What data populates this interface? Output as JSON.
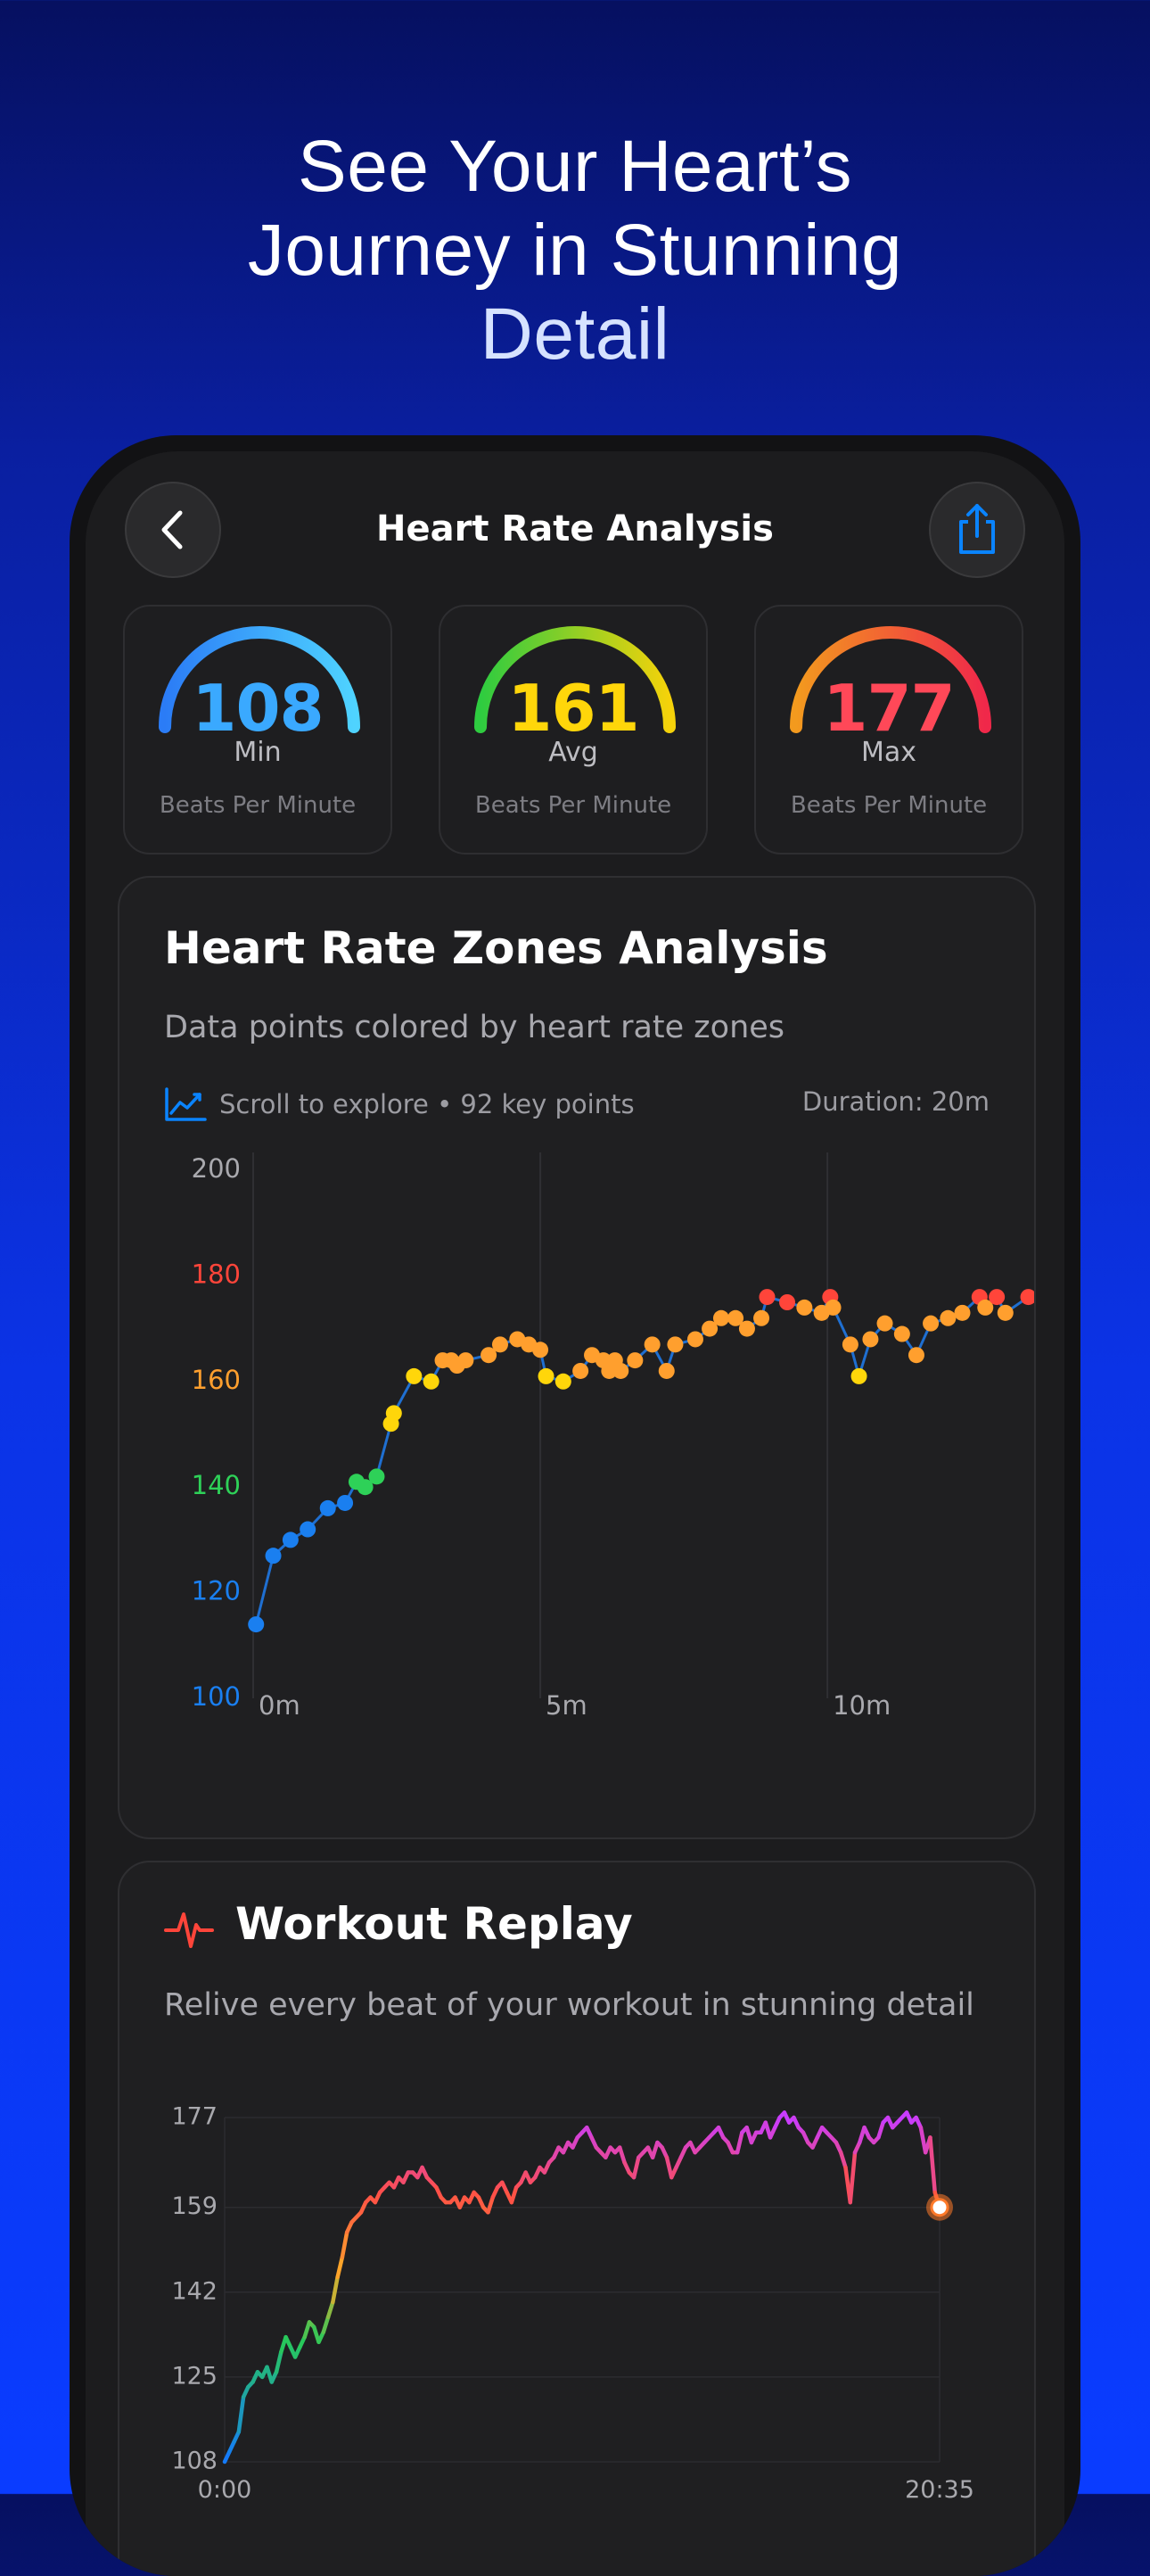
{
  "promo": {
    "line1": "See Your Heart’s",
    "line2": "Journey in Stunning",
    "line3": "Detail"
  },
  "nav": {
    "title": "Heart Rate Analysis"
  },
  "gauges": [
    {
      "value": "108",
      "label": "Min",
      "unit": "Beats Per Minute",
      "colors": [
        "#2b7cf6",
        "#4fd3ff"
      ]
    },
    {
      "value": "161",
      "label": "Avg",
      "unit": "Beats Per Minute",
      "colors": [
        "#2ecc40",
        "#f5d20a"
      ]
    },
    {
      "value": "177",
      "label": "Max",
      "unit": "Beats Per Minute",
      "colors": [
        "#f39a1e",
        "#f0284a"
      ]
    }
  ],
  "zones": {
    "title": "Heart Rate Zones Analysis",
    "subtitle": "Data points colored by heart rate zones",
    "scroll_hint": "Scroll to explore • 92 key points",
    "duration": "Duration: 20m"
  },
  "replay": {
    "title": "Workout Replay",
    "subtitle": "Relive every beat of your workout in stunning detail"
  },
  "colors": {
    "zone_blue": "#1a7ff0",
    "zone_green": "#2ed158",
    "zone_yellow": "#ffd60a",
    "zone_orange": "#ff9f2e",
    "zone_red": "#ff453a",
    "accent": "#0a84ff"
  },
  "chart_data": [
    {
      "type": "scatter",
      "title": "Heart Rate Zones Analysis",
      "xlabel": "",
      "ylabel": "",
      "ylim": [
        100,
        200
      ],
      "xlim": [
        0,
        13.6
      ],
      "y_ticks": [
        {
          "label": "200",
          "value": 200,
          "color": "#a9a9ae"
        },
        {
          "label": "180",
          "value": 180,
          "color": "#ff453a"
        },
        {
          "label": "160",
          "value": 160,
          "color": "#ff9f2e"
        },
        {
          "label": "140",
          "value": 140,
          "color": "#2ed158"
        },
        {
          "label": "120",
          "value": 120,
          "color": "#1a7ff0"
        },
        {
          "label": "100",
          "value": 100,
          "color": "#1a7ff0"
        }
      ],
      "x_ticks": [
        {
          "label": "0m",
          "value": 0
        },
        {
          "label": "5m",
          "value": 5
        },
        {
          "label": "10m",
          "value": 10
        }
      ],
      "points": [
        [
          0.05,
          114
        ],
        [
          0.35,
          127
        ],
        [
          0.65,
          130
        ],
        [
          0.95,
          132
        ],
        [
          1.3,
          136
        ],
        [
          1.6,
          137
        ],
        [
          1.8,
          141
        ],
        [
          1.95,
          140
        ],
        [
          2.15,
          142
        ],
        [
          2.4,
          152
        ],
        [
          2.45,
          154
        ],
        [
          2.8,
          161
        ],
        [
          3.1,
          160
        ],
        [
          3.3,
          164
        ],
        [
          3.45,
          164
        ],
        [
          3.55,
          163
        ],
        [
          3.7,
          164
        ],
        [
          4.1,
          165
        ],
        [
          4.3,
          167
        ],
        [
          4.6,
          168
        ],
        [
          4.8,
          167
        ],
        [
          5.0,
          166
        ],
        [
          5.1,
          161
        ],
        [
          5.4,
          160
        ],
        [
          5.7,
          162
        ],
        [
          5.9,
          165
        ],
        [
          6.1,
          164
        ],
        [
          6.2,
          162
        ],
        [
          6.3,
          164
        ],
        [
          6.4,
          162
        ],
        [
          6.65,
          164
        ],
        [
          6.95,
          167
        ],
        [
          7.2,
          162
        ],
        [
          7.35,
          167
        ],
        [
          7.7,
          168
        ],
        [
          7.95,
          170
        ],
        [
          8.15,
          172
        ],
        [
          8.4,
          172
        ],
        [
          8.6,
          170
        ],
        [
          8.85,
          172
        ],
        [
          8.95,
          176
        ],
        [
          9.3,
          175
        ],
        [
          9.6,
          174
        ],
        [
          9.9,
          173
        ],
        [
          10.05,
          176
        ],
        [
          10.1,
          174
        ],
        [
          10.4,
          167
        ],
        [
          10.55,
          161
        ],
        [
          10.75,
          168
        ],
        [
          11.0,
          171
        ],
        [
          11.3,
          169
        ],
        [
          11.55,
          165
        ],
        [
          11.8,
          171
        ],
        [
          12.1,
          172
        ],
        [
          12.35,
          173
        ],
        [
          12.65,
          176
        ],
        [
          12.75,
          174
        ],
        [
          12.95,
          176
        ],
        [
          13.1,
          173
        ],
        [
          13.5,
          176
        ]
      ]
    },
    {
      "type": "line",
      "title": "Workout Replay",
      "xlabel": "",
      "ylabel": "",
      "ylim": [
        108,
        177
      ],
      "y_ticks": [
        "177",
        "159",
        "142",
        "125",
        "108"
      ],
      "x_ticks": [
        "0:00",
        "20:35"
      ],
      "values": [
        108,
        110,
        112,
        114,
        121,
        123,
        124,
        126,
        125,
        127,
        124,
        126,
        130,
        133,
        131,
        129,
        131,
        133,
        136,
        135,
        132,
        134,
        137,
        140,
        145,
        149,
        154,
        156,
        157,
        158,
        160,
        161,
        160,
        162,
        163,
        164,
        163,
        165,
        164,
        166,
        166,
        165,
        167,
        165,
        164,
        163,
        161,
        160,
        160,
        161,
        159,
        161,
        160,
        162,
        161,
        159,
        158,
        161,
        163,
        164,
        162,
        160,
        163,
        164,
        166,
        164,
        165,
        167,
        166,
        168,
        169,
        171,
        170,
        172,
        171,
        173,
        174,
        175,
        173,
        171,
        170,
        169,
        171,
        170,
        171,
        168,
        166,
        165,
        169,
        170,
        171,
        169,
        172,
        171,
        169,
        165,
        167,
        169,
        171,
        172,
        170,
        171,
        172,
        173,
        174,
        175,
        173,
        172,
        170,
        170,
        174,
        175,
        172,
        174,
        174,
        176,
        173,
        175,
        177,
        178,
        176,
        177,
        175,
        174,
        172,
        171,
        173,
        175,
        174,
        173,
        172,
        170,
        167,
        160,
        170,
        172,
        175,
        173,
        172,
        173,
        176,
        177,
        175,
        176,
        177,
        178,
        176,
        177,
        175,
        170,
        173,
        162,
        159
      ]
    }
  ]
}
